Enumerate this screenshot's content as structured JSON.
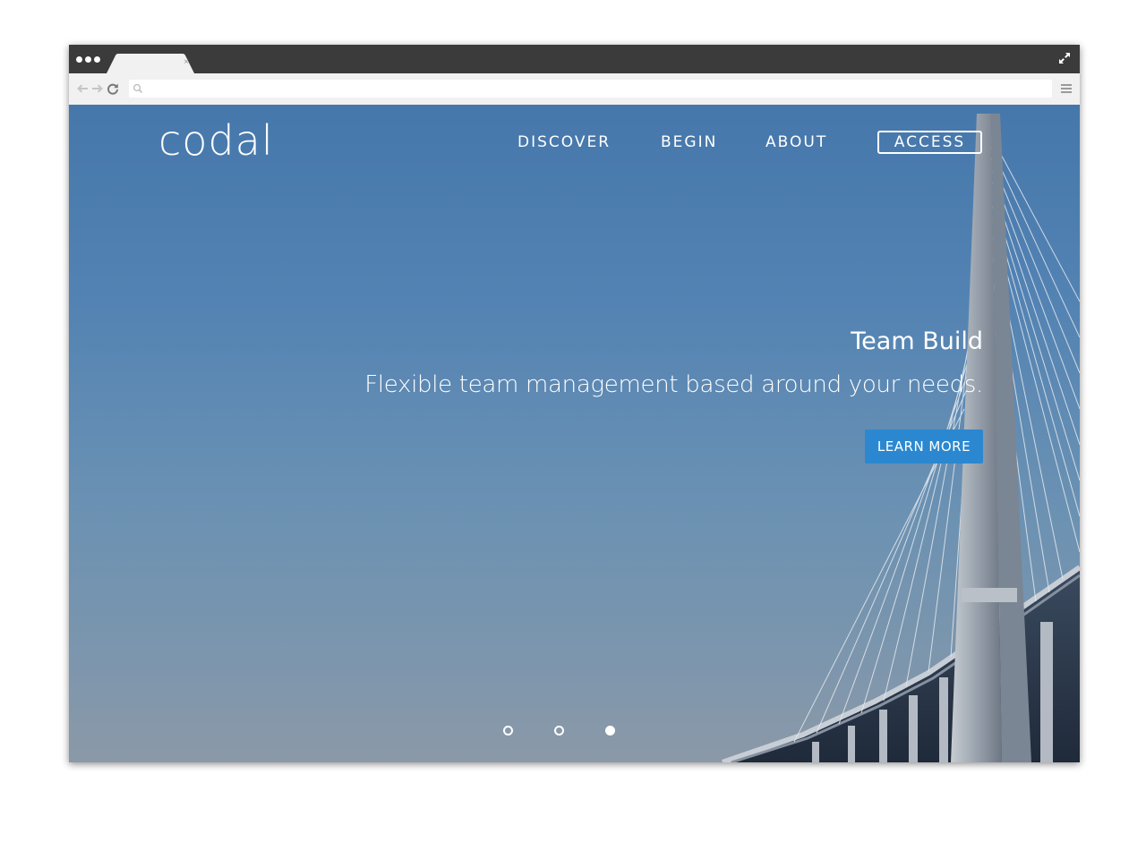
{
  "browser": {
    "tab": {
      "title": "",
      "close_label": "×"
    },
    "url": {
      "value": "",
      "placeholder": ""
    },
    "icons": {
      "window_dots": "window-dots",
      "back": "back-arrow-icon",
      "forward": "forward-arrow-icon",
      "reload": "reload-icon",
      "search": "search-icon",
      "menu": "hamburger-menu-icon",
      "expand": "expand-icon"
    }
  },
  "site": {
    "logo": "codal",
    "nav": {
      "discover": "DISCOVER",
      "begin": "BEGIN",
      "about": "ABOUT",
      "access": "ACCESS"
    },
    "hero": {
      "title": "Team Build",
      "subtitle": "Flexible team management based around your needs.",
      "cta_label": "LEARN MORE"
    },
    "carousel": {
      "slide_count": 3,
      "active_slide": 3
    }
  },
  "colors": {
    "titlebar": "#3b3b3b",
    "toolbar": "#f1f1f1",
    "sky_top": "#4677ab",
    "sky_bottom": "#8b99a8",
    "cta": "#2b88d0",
    "text": "#ffffff"
  }
}
